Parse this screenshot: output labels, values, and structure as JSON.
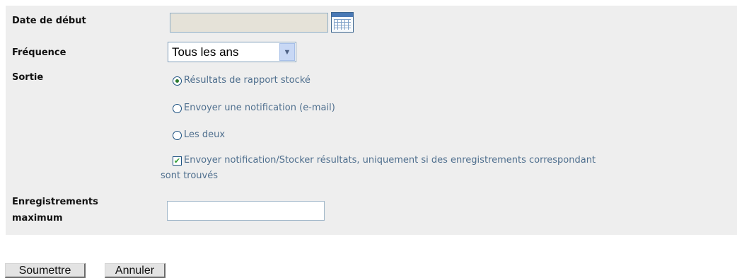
{
  "form": {
    "start_date": {
      "label": "Date de début",
      "value": ""
    },
    "frequency": {
      "label": "Fréquence",
      "selected": "Tous les ans"
    },
    "output": {
      "label": "Sortie",
      "options": [
        "Résultats de rapport stocké",
        "Envoyer une notification (e-mail)",
        "Les deux"
      ],
      "selected_index": 0,
      "only_if_match_line1": "Envoyer notification/Stocker résultats, uniquement si des enregistrements correspondant",
      "only_if_match_line2": "sont trouvés",
      "only_if_match_checked": true
    },
    "max_records": {
      "label_line1": "Enregistrements",
      "label_line2": "maximum",
      "value": ""
    }
  },
  "buttons": {
    "submit": "Soumettre",
    "cancel": "Annuler"
  },
  "colors": {
    "panel_bg": "#eeeeee",
    "option_text": "#4f6f8e",
    "calendar_accent": "#4a79b5"
  }
}
